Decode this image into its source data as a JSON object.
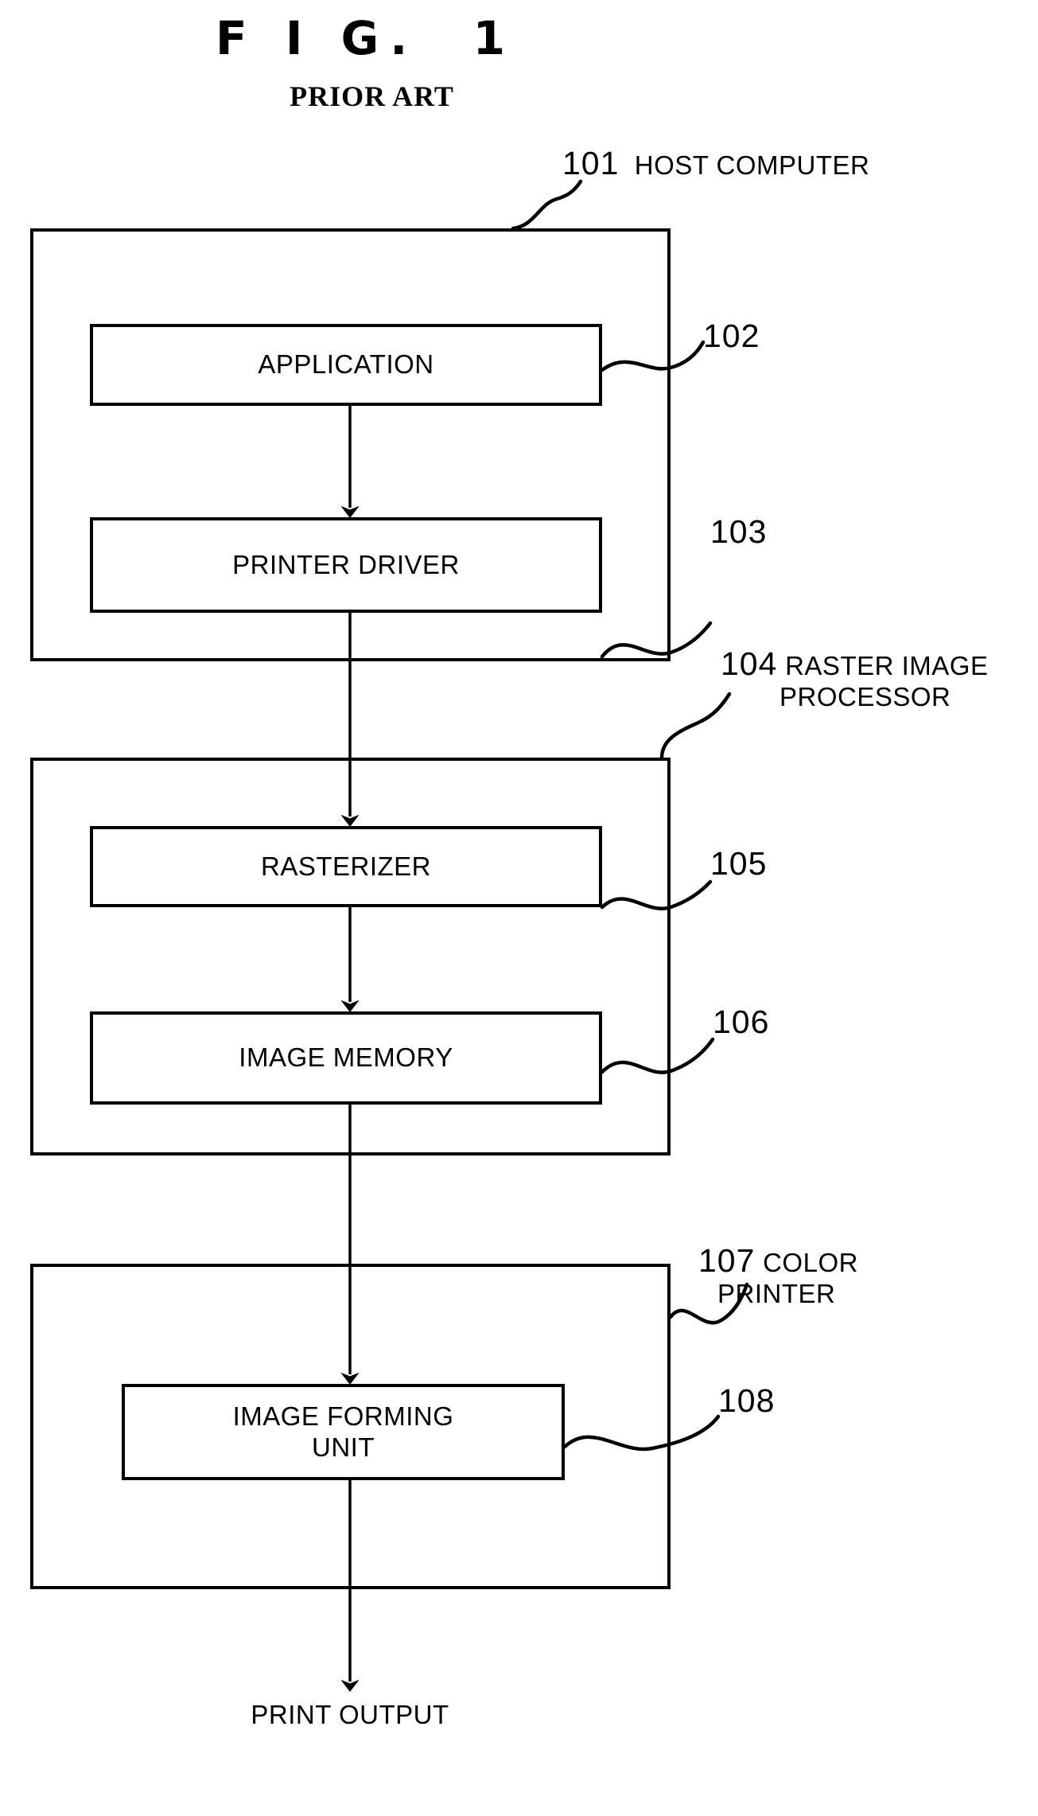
{
  "figure": {
    "title": "F I G.  1",
    "subtitle": "PRIOR ART"
  },
  "blocks": {
    "host_computer": {
      "ref": "101",
      "name": "HOST COMPUTER",
      "children": {
        "application": {
          "ref": "102",
          "label": "APPLICATION"
        },
        "printer_driver": {
          "ref": "103",
          "label": "PRINTER DRIVER"
        }
      }
    },
    "raster_image_processor": {
      "ref": "104",
      "name_line1": "RASTER IMAGE",
      "name_line2": "PROCESSOR",
      "children": {
        "rasterizer": {
          "ref": "105",
          "label": "RASTERIZER"
        },
        "image_memory": {
          "ref": "106",
          "label": "IMAGE MEMORY"
        }
      }
    },
    "color_printer": {
      "ref": "107",
      "name_line1": "COLOR",
      "name_line2": "PRINTER",
      "children": {
        "image_forming_unit": {
          "ref": "108",
          "label": "IMAGE FORMING\nUNIT"
        }
      }
    }
  },
  "output": {
    "label": "PRINT OUTPUT"
  },
  "style": {
    "ink": "#000000",
    "paper": "#ffffff"
  }
}
